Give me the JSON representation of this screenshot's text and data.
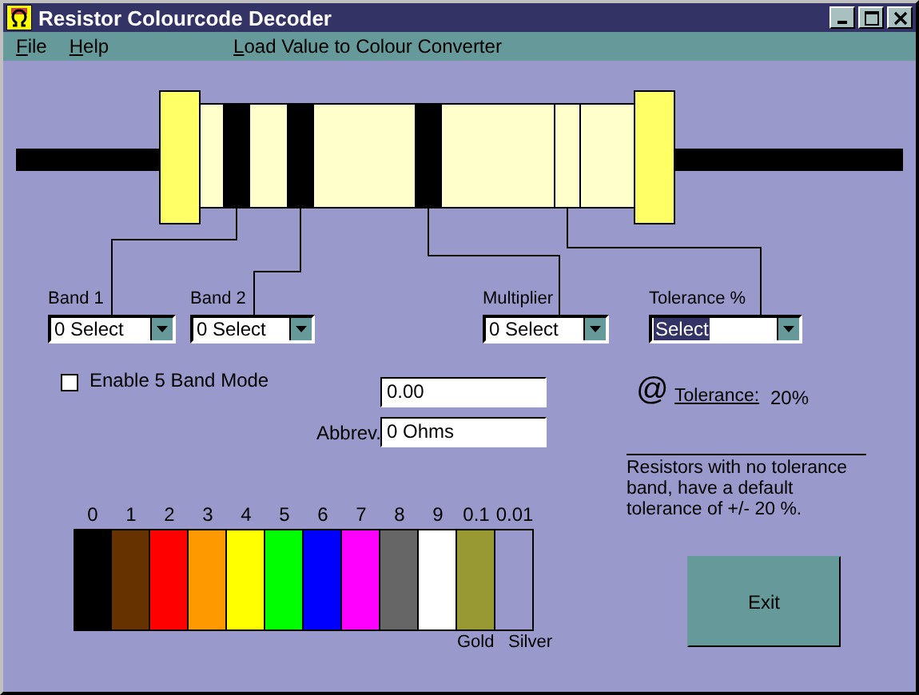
{
  "window": {
    "title": "Resistor Colourcode Decoder"
  },
  "menu": [
    {
      "label": "File"
    },
    {
      "label": "Help"
    },
    {
      "label": "Load Value to Colour Converter"
    }
  ],
  "resistor": {
    "bands": [
      {
        "color": "#000000"
      },
      {
        "color": "#000000"
      },
      {
        "color": "#000000"
      },
      {
        "color": "#ffffcc"
      }
    ]
  },
  "selectors": [
    {
      "label": "Band 1",
      "value": "0 Select",
      "highlighted": false
    },
    {
      "label": "Band 2",
      "value": "0 Select",
      "highlighted": false
    },
    {
      "label": "Multiplier",
      "value": "0 Select",
      "highlighted": false
    },
    {
      "label": "Tolerance %",
      "value": "Select",
      "highlighted": true
    }
  ],
  "five_band_mode": {
    "label": "Enable 5 Band Mode",
    "checked": false
  },
  "value_field": {
    "value": "0.00"
  },
  "abbrev": {
    "label": "Abbrev.",
    "value": "0 Ohms"
  },
  "tolerance": {
    "symbol": "@",
    "label": "Tolerance:",
    "value": "20%"
  },
  "note": "Resistors with no tolerance band, have a default tolerance of +/- 20 %.",
  "colour_chart": [
    {
      "label": "0",
      "color": "#000000"
    },
    {
      "label": "1",
      "color": "#663300"
    },
    {
      "label": "2",
      "color": "#ff0000"
    },
    {
      "label": "3",
      "color": "#ff9900"
    },
    {
      "label": "4",
      "color": "#ffff00"
    },
    {
      "label": "5",
      "color": "#00ff00"
    },
    {
      "label": "6",
      "color": "#0000ff"
    },
    {
      "label": "7",
      "color": "#ff00ff"
    },
    {
      "label": "8",
      "color": "#666666"
    },
    {
      "label": "9",
      "color": "#ffffff"
    },
    {
      "label": "0.1",
      "color": "#999933",
      "name": "Gold"
    },
    {
      "label": "0.01",
      "color": "#9999cc",
      "name": "Silver"
    }
  ],
  "exit_button": "Exit"
}
